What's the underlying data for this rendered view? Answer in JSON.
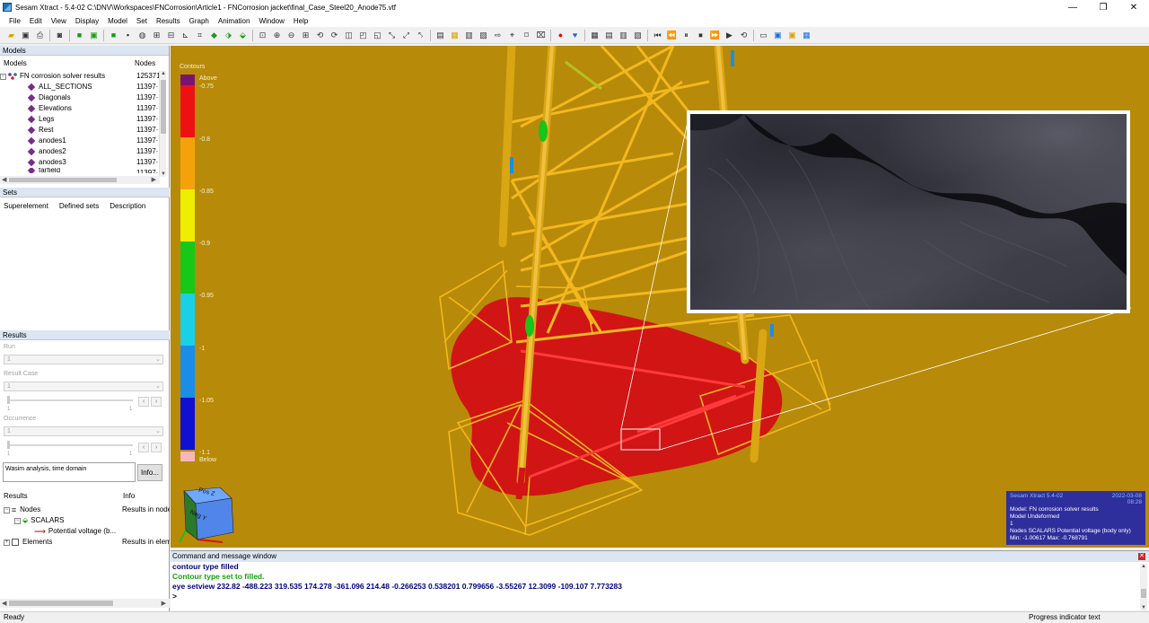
{
  "window": {
    "title": "Sesam Xtract - 5.4-02 C:\\DNV\\Workspaces\\FNCorrosion\\Article1 - FNCorrosion jacket\\final_Case_Steel20_Anode75.vtf",
    "controls": [
      "—",
      "❐",
      "✕"
    ]
  },
  "menu": [
    "File",
    "Edit",
    "View",
    "Display",
    "Model",
    "Set",
    "Results",
    "Graph",
    "Animation",
    "Window",
    "Help"
  ],
  "models": {
    "header": "Models",
    "col_models": "Models",
    "col_nodes": "Nodes",
    "root": {
      "name": "FN corrosion solver results",
      "nodes": "125371·"
    },
    "items": [
      {
        "name": "ALL_SECTIONS",
        "nodes": "11397·"
      },
      {
        "name": "Diagonals",
        "nodes": "11397·"
      },
      {
        "name": "Elevations",
        "nodes": "11397·"
      },
      {
        "name": "Legs",
        "nodes": "11397·"
      },
      {
        "name": "Rest",
        "nodes": "11397·"
      },
      {
        "name": "anodes1",
        "nodes": "11397·"
      },
      {
        "name": "anodes2",
        "nodes": "11397·"
      },
      {
        "name": "anodes3",
        "nodes": "11397·"
      },
      {
        "name": "farfield",
        "nodes": "11397·"
      }
    ]
  },
  "sets": {
    "header": "Sets",
    "columns": [
      "Superelement",
      "Defined sets",
      "Description"
    ]
  },
  "results": {
    "header": "Results",
    "run_label": "Run",
    "run_value": "1",
    "result_case_label": "Result Case",
    "result_case_value": "1",
    "slider_min": "1",
    "slider_max": "1",
    "occurrence_label": "Occurrence",
    "occurrence_value": "1",
    "analysis_text": "Wasim analysis, time domain",
    "info_button": "Info...",
    "tree_col_results": "Results",
    "tree_col_info": "Info",
    "tree": [
      {
        "name": "Nodes",
        "info": "Results in nodes"
      },
      {
        "name": "SCALARS",
        "info": ""
      },
      {
        "name": "Potential voltage (b...",
        "info": ""
      },
      {
        "name": "Elements",
        "info": "Results in elements"
      }
    ]
  },
  "legend": {
    "title": "Contours",
    "above": "Above",
    "below": "Below",
    "labels": [
      "-0.75",
      "-0.8",
      "-0.85",
      "-0.9",
      "-0.95",
      "-1",
      "-1.05",
      "-1.1"
    ],
    "colors": {
      "above": "#7b1470",
      "bands": [
        "#ee1111",
        "#f4a20c",
        "#eeee00",
        "#18c818",
        "#1ad0e6",
        "#1a8ee6",
        "#1010d0"
      ],
      "below": "#f5b8b8"
    }
  },
  "axis_cube": {
    "top_label": "Pos Z",
    "side_label": "Neg Y"
  },
  "info_box": {
    "app": "Sesam Xtract 5.4-02",
    "date": "2022-03-08",
    "time": "08:28",
    "lines": [
      "Model: FN corrosion solver results",
      "Model Undeformed",
      "1",
      "Nodes SCALARS Potential voltage (body only)",
      "Min: -1.00617 Max: -0.768791"
    ]
  },
  "command_window": {
    "header": "Command and message window",
    "lines": [
      {
        "text": "contour type filled",
        "color": "#00007f"
      },
      {
        "text": "Contour type set to filled.",
        "color": "#13a10e"
      },
      {
        "text": "eye setview 232.82 -488.223 319.535 174.278 -361.096 214.48 -0.266253 0.538201 0.799656 -3.55267 12.3099 -109.107 7.773283",
        "color": "#00007f"
      },
      {
        "text": ">",
        "color": "#000000"
      }
    ]
  },
  "status": {
    "left": "Ready",
    "right": "Progress indicator text"
  },
  "colors": {
    "viewport_bg": "#b88a09",
    "structure": "#f2b81e",
    "contour_red": "#d11414",
    "info_box_bg": "#2e2e9c"
  }
}
